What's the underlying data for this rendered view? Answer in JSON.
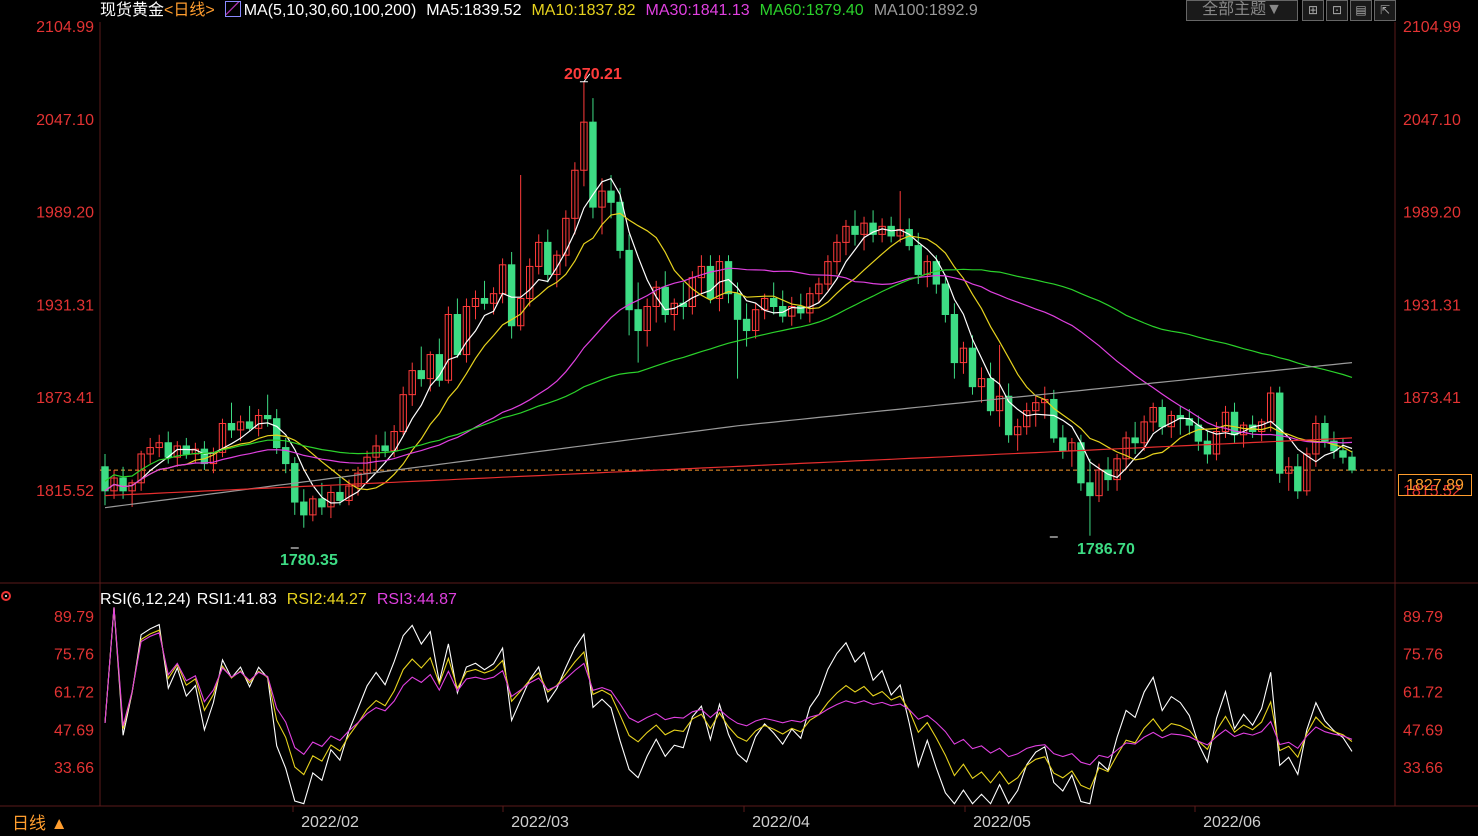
{
  "header": {
    "symbol": "现货黄金",
    "period_tag": "<日线>",
    "ma_title": "MA(5,10,30,60,100,200)",
    "ma_values": [
      {
        "label": "MA5:1839.52",
        "color": "#ffffff"
      },
      {
        "label": "MA10:1837.82",
        "color": "#e6d21e"
      },
      {
        "label": "MA30:1841.13",
        "color": "#e040e0"
      },
      {
        "label": "MA60:1879.40",
        "color": "#2bd12b"
      },
      {
        "label": "MA100:1892.9",
        "color": "#9a9a9a"
      }
    ],
    "theme_button": "全部主题▼"
  },
  "toolbar_icons": [
    "grid-icon",
    "maximize-icon",
    "chart-icon",
    "export-icon"
  ],
  "price_axis": {
    "ticks": [
      "2104.99",
      "2047.10",
      "1989.20",
      "1931.31",
      "1873.41",
      "1815.52"
    ],
    "color": "#e33333"
  },
  "current_price": "1827.89",
  "annotations": {
    "high": "2070.21",
    "low1": "1780.35",
    "low2": "1786.70"
  },
  "rsi": {
    "title": "RSI(6,12,24)",
    "values": [
      {
        "label": "RSI1:41.83",
        "color": "#ffffff"
      },
      {
        "label": "RSI2:44.27",
        "color": "#e6d21e"
      },
      {
        "label": "RSI3:44.87",
        "color": "#e040e0"
      }
    ],
    "ticks": [
      "89.79",
      "75.76",
      "61.72",
      "47.69",
      "33.66"
    ]
  },
  "x_axis": [
    "2022/02",
    "2022/03",
    "2022/04",
    "2022/05",
    "2022/06"
  ],
  "period_button": "日线 ▲",
  "colors": {
    "up": "#ff3b3b",
    "down": "#3ddc84",
    "ma200": "#e62e2e"
  },
  "chart_data": {
    "type": "candlestick",
    "instrument": "现货黄金",
    "ylim": [
      1780.35,
      2104.99
    ],
    "candles": [
      [
        1830,
        1838,
        1806,
        1815
      ],
      [
        1815,
        1828,
        1810,
        1823
      ],
      [
        1823,
        1830,
        1810,
        1815
      ],
      [
        1815,
        1822,
        1805,
        1820
      ],
      [
        1820,
        1840,
        1815,
        1838
      ],
      [
        1838,
        1848,
        1832,
        1842
      ],
      [
        1842,
        1850,
        1836,
        1845
      ],
      [
        1845,
        1852,
        1832,
        1836
      ],
      [
        1836,
        1846,
        1830,
        1843
      ],
      [
        1843,
        1848,
        1835,
        1838
      ],
      [
        1838,
        1845,
        1832,
        1841
      ],
      [
        1841,
        1846,
        1828,
        1832
      ],
      [
        1832,
        1842,
        1826,
        1839
      ],
      [
        1839,
        1860,
        1836,
        1857
      ],
      [
        1857,
        1870,
        1848,
        1853
      ],
      [
        1853,
        1862,
        1846,
        1858
      ],
      [
        1858,
        1868,
        1852,
        1854
      ],
      [
        1854,
        1866,
        1849,
        1862
      ],
      [
        1862,
        1875,
        1855,
        1860
      ],
      [
        1860,
        1866,
        1838,
        1842
      ],
      [
        1842,
        1848,
        1826,
        1832
      ],
      [
        1832,
        1836,
        1800,
        1808
      ],
      [
        1808,
        1816,
        1792,
        1800
      ],
      [
        1800,
        1812,
        1796,
        1810
      ],
      [
        1810,
        1820,
        1800,
        1805
      ],
      [
        1805,
        1818,
        1798,
        1814
      ],
      [
        1814,
        1824,
        1806,
        1809
      ],
      [
        1809,
        1822,
        1806,
        1818
      ],
      [
        1818,
        1830,
        1812,
        1826
      ],
      [
        1826,
        1840,
        1820,
        1836
      ],
      [
        1836,
        1850,
        1828,
        1843
      ],
      [
        1843,
        1852,
        1836,
        1840
      ],
      [
        1840,
        1856,
        1836,
        1852
      ],
      [
        1852,
        1880,
        1850,
        1875
      ],
      [
        1875,
        1895,
        1868,
        1890
      ],
      [
        1890,
        1905,
        1880,
        1885
      ],
      [
        1885,
        1902,
        1877,
        1900
      ],
      [
        1900,
        1910,
        1880,
        1884
      ],
      [
        1884,
        1930,
        1882,
        1925
      ],
      [
        1925,
        1935,
        1898,
        1900
      ],
      [
        1900,
        1935,
        1895,
        1930
      ],
      [
        1930,
        1940,
        1922,
        1935
      ],
      [
        1935,
        1946,
        1928,
        1932
      ],
      [
        1932,
        1942,
        1925,
        1938
      ],
      [
        1938,
        1960,
        1932,
        1956
      ],
      [
        1956,
        1964,
        1910,
        1918
      ],
      [
        1918,
        2012,
        1915,
        1935
      ],
      [
        1935,
        1960,
        1930,
        1955
      ],
      [
        1955,
        1975,
        1950,
        1970
      ],
      [
        1970,
        1978,
        1945,
        1950
      ],
      [
        1950,
        1965,
        1942,
        1962
      ],
      [
        1962,
        1990,
        1955,
        1985
      ],
      [
        1985,
        2020,
        1975,
        2015
      ],
      [
        2015,
        2070,
        2005,
        2045
      ],
      [
        2045,
        2060,
        1985,
        1992
      ],
      [
        1992,
        2010,
        1975,
        2002
      ],
      [
        2002,
        2012,
        1985,
        1995
      ],
      [
        1995,
        2004,
        1960,
        1965
      ],
      [
        1965,
        1975,
        1912,
        1928
      ],
      [
        1928,
        1945,
        1895,
        1915
      ],
      [
        1915,
        1935,
        1905,
        1930
      ],
      [
        1930,
        1946,
        1920,
        1942
      ],
      [
        1942,
        1952,
        1920,
        1925
      ],
      [
        1925,
        1935,
        1915,
        1932
      ],
      [
        1932,
        1945,
        1922,
        1930
      ],
      [
        1930,
        1952,
        1925,
        1948
      ],
      [
        1948,
        1962,
        1938,
        1955
      ],
      [
        1955,
        1962,
        1932,
        1935
      ],
      [
        1935,
        1962,
        1927,
        1958
      ],
      [
        1958,
        1962,
        1932,
        1938
      ],
      [
        1938,
        1945,
        1885,
        1922
      ],
      [
        1922,
        1932,
        1905,
        1915
      ],
      [
        1915,
        1932,
        1910,
        1928
      ],
      [
        1928,
        1938,
        1922,
        1935
      ],
      [
        1935,
        1945,
        1925,
        1930
      ],
      [
        1930,
        1940,
        1920,
        1924
      ],
      [
        1924,
        1936,
        1918,
        1930
      ],
      [
        1930,
        1938,
        1922,
        1926
      ],
      [
        1926,
        1942,
        1920,
        1938
      ],
      [
        1938,
        1948,
        1932,
        1944
      ],
      [
        1944,
        1962,
        1940,
        1958
      ],
      [
        1958,
        1975,
        1950,
        1970
      ],
      [
        1970,
        1984,
        1962,
        1980
      ],
      [
        1980,
        1990,
        1968,
        1975
      ],
      [
        1975,
        1986,
        1965,
        1982
      ],
      [
        1982,
        1990,
        1970,
        1975
      ],
      [
        1975,
        1985,
        1970,
        1980
      ],
      [
        1980,
        1986,
        1970,
        1974
      ],
      [
        1974,
        2002,
        1970,
        1978
      ],
      [
        1978,
        1985,
        1965,
        1968
      ],
      [
        1968,
        1976,
        1944,
        1950
      ],
      [
        1950,
        1962,
        1942,
        1958
      ],
      [
        1958,
        1962,
        1938,
        1944
      ],
      [
        1944,
        1950,
        1920,
        1925
      ],
      [
        1925,
        1932,
        1885,
        1895
      ],
      [
        1895,
        1908,
        1888,
        1904
      ],
      [
        1904,
        1912,
        1875,
        1880
      ],
      [
        1880,
        1892,
        1870,
        1885
      ],
      [
        1885,
        1895,
        1862,
        1865
      ],
      [
        1865,
        1906,
        1855,
        1874
      ],
      [
        1874,
        1882,
        1845,
        1850
      ],
      [
        1850,
        1860,
        1840,
        1855
      ],
      [
        1855,
        1870,
        1850,
        1865
      ],
      [
        1865,
        1875,
        1855,
        1870
      ],
      [
        1870,
        1880,
        1860,
        1872
      ],
      [
        1872,
        1878,
        1845,
        1848
      ],
      [
        1848,
        1856,
        1835,
        1840
      ],
      [
        1840,
        1848,
        1830,
        1845
      ],
      [
        1845,
        1850,
        1815,
        1820
      ],
      [
        1820,
        1835,
        1787,
        1812
      ],
      [
        1812,
        1832,
        1808,
        1828
      ],
      [
        1828,
        1836,
        1815,
        1822
      ],
      [
        1822,
        1838,
        1815,
        1835
      ],
      [
        1835,
        1852,
        1828,
        1848
      ],
      [
        1848,
        1858,
        1838,
        1845
      ],
      [
        1845,
        1862,
        1840,
        1858
      ],
      [
        1858,
        1870,
        1852,
        1867
      ],
      [
        1867,
        1872,
        1850,
        1855
      ],
      [
        1855,
        1865,
        1848,
        1862
      ],
      [
        1862,
        1868,
        1850,
        1860
      ],
      [
        1860,
        1866,
        1850,
        1856
      ],
      [
        1856,
        1862,
        1840,
        1846
      ],
      [
        1846,
        1852,
        1832,
        1838
      ],
      [
        1838,
        1858,
        1834,
        1852
      ],
      [
        1852,
        1868,
        1848,
        1864
      ],
      [
        1864,
        1870,
        1845,
        1850
      ],
      [
        1850,
        1858,
        1842,
        1856
      ],
      [
        1856,
        1862,
        1848,
        1852
      ],
      [
        1852,
        1860,
        1846,
        1858
      ],
      [
        1858,
        1880,
        1852,
        1876
      ],
      [
        1876,
        1880,
        1820,
        1826
      ],
      [
        1826,
        1836,
        1815,
        1830
      ],
      [
        1830,
        1838,
        1810,
        1815
      ],
      [
        1815,
        1842,
        1812,
        1838
      ],
      [
        1838,
        1862,
        1830,
        1857
      ],
      [
        1857,
        1862,
        1842,
        1846
      ],
      [
        1846,
        1852,
        1835,
        1840
      ],
      [
        1840,
        1848,
        1832,
        1836
      ],
      [
        1836,
        1840,
        1826,
        1828
      ]
    ],
    "ma_series": [
      {
        "name": "MA5",
        "color": "#ffffff"
      },
      {
        "name": "MA10",
        "color": "#e6d21e"
      },
      {
        "name": "MA30",
        "color": "#e040e0"
      },
      {
        "name": "MA60",
        "color": "#2bd12b"
      },
      {
        "name": "MA100",
        "color": "#9a9a9a"
      },
      {
        "color": "#e62e2e"
      }
    ],
    "reference_line": 1827.89,
    "rsi": {
      "ylim": [
        20,
        95
      ],
      "series": [
        {
          "name": "RSI1",
          "color": "#ffffff"
        },
        {
          "name": "RSI2",
          "color": "#e6d21e"
        },
        {
          "name": "RSI3",
          "color": "#e040e0"
        }
      ]
    },
    "x_labels": [
      "2022/02",
      "2022/03",
      "2022/04",
      "2022/05",
      "2022/06"
    ]
  }
}
